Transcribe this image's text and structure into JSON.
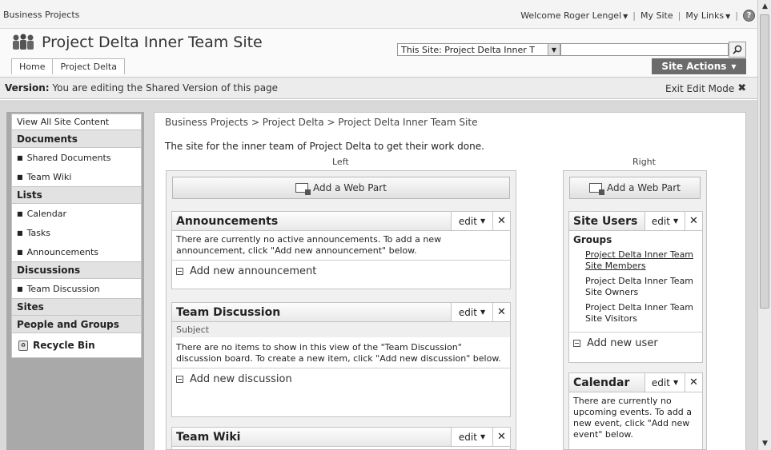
{
  "top": {
    "site_collection": "Business Projects",
    "welcome": "Welcome Roger Lengel",
    "my_site": "My Site",
    "my_links": "My Links",
    "separator": "|"
  },
  "header": {
    "title": "Project Delta Inner Team Site",
    "scope": "This Site: Project Delta Inner T",
    "search_value": "",
    "tabs": [
      "Home",
      "Project Delta"
    ],
    "site_actions": "Site Actions"
  },
  "version_bar": {
    "label": "Version:",
    "text": "You are editing the Shared Version of this page",
    "exit": "Exit Edit Mode"
  },
  "quick_launch": {
    "view_all": "View All Site Content",
    "documents": "Documents",
    "doc_items": [
      "Shared Documents",
      "Team Wiki"
    ],
    "lists": "Lists",
    "list_items": [
      "Calendar",
      "Tasks",
      "Announcements"
    ],
    "discussions": "Discussions",
    "disc_items": [
      "Team Discussion"
    ],
    "sites": "Sites",
    "people": "People and Groups",
    "recycle": "Recycle Bin"
  },
  "main": {
    "breadcrumb": "Business Projects > Project Delta > Project Delta Inner Team Site",
    "description": "The site for the inner team of Project Delta to get their work done.",
    "left_zone": "Left",
    "right_zone": "Right",
    "add_web_part": "Add a Web Part",
    "edit_label": "edit",
    "close_glyph": "✕"
  },
  "webparts": {
    "announcements": {
      "title": "Announcements",
      "body": "There are currently no active announcements. To add a new announcement, click \"Add new announcement\" below.",
      "add": "Add new announcement"
    },
    "discussion": {
      "title": "Team Discussion",
      "column": "Subject",
      "body": "There are no items to show in this view of the \"Team Discussion\" discussion board. To create a new item, click \"Add new discussion\" below.",
      "add": "Add new discussion"
    },
    "wiki": {
      "title": "Team Wiki"
    },
    "site_users": {
      "title": "Site Users",
      "groups": "Groups",
      "members": "Project Delta Inner Team Site Members",
      "owners": "Project Delta Inner Team Site Owners",
      "visitors": "Project Delta Inner Team Site Visitors",
      "add": "Add new user"
    },
    "calendar": {
      "title": "Calendar",
      "body": "There are currently no upcoming events. To add a new event, click \"Add new event\" below."
    }
  },
  "icons": {
    "logo": "people-logo-icon",
    "help": "help-icon",
    "search": "search-icon",
    "recycle": "recycle-bin-icon"
  }
}
